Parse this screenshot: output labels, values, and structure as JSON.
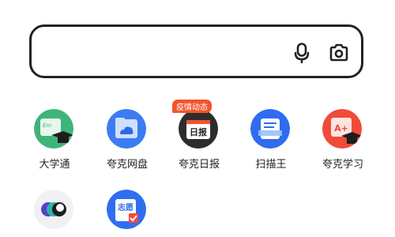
{
  "search": {
    "placeholder": "",
    "value": ""
  },
  "apps": [
    {
      "label": "大学通",
      "icon": "graduation-cap-icon",
      "color": "#3fb47a"
    },
    {
      "label": "夸克网盘",
      "icon": "cloud-drive-icon",
      "color": "#3b7cf2"
    },
    {
      "label": "夸克日报",
      "icon": "daily-news-icon",
      "color": "#2d2d2d",
      "badge": "疫情动态",
      "icon_text": "日报"
    },
    {
      "label": "扫描王",
      "icon": "scanner-icon",
      "color": "#2f6cf0"
    },
    {
      "label": "夸克学习",
      "icon": "study-icon",
      "color": "#f04a3a",
      "icon_text": "A+"
    },
    {
      "label": "",
      "icon": "multi-color-app-icon",
      "color": "#5a3fc8"
    },
    {
      "label": "",
      "icon": "volunteer-app-icon",
      "color": "#2f6ef0",
      "icon_text": "志愿"
    }
  ]
}
